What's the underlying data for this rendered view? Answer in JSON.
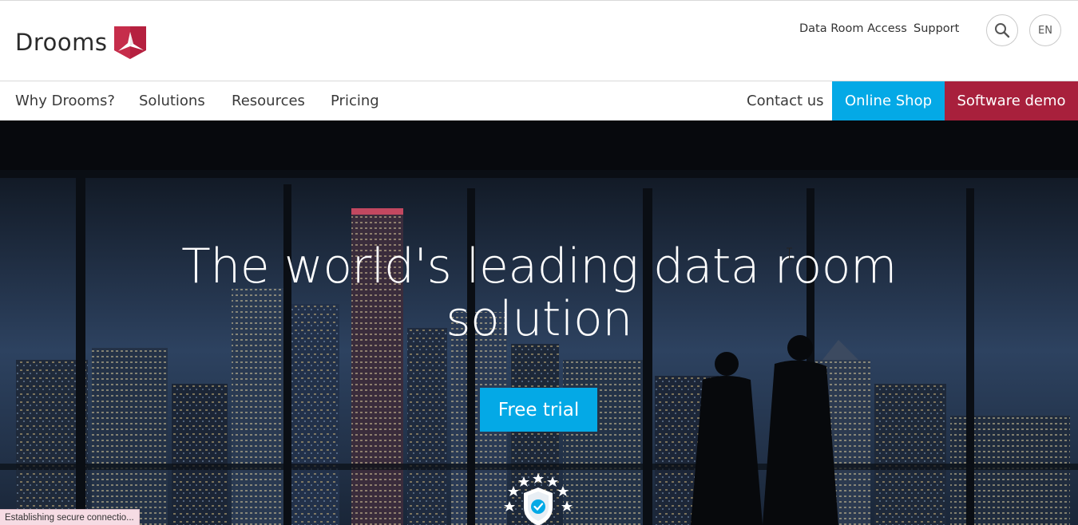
{
  "header": {
    "logo_text": "Drooms",
    "top_links": [
      "Data Room Access",
      "Support"
    ],
    "search_icon": "search-icon",
    "language": "EN"
  },
  "nav": {
    "items": [
      "Why Drooms?",
      "Solutions",
      "Resources",
      "Pricing"
    ],
    "contact": "Contact us",
    "online_shop": "Online Shop",
    "software_demo": "Software demo"
  },
  "hero": {
    "title_line1": "The world's leading data room",
    "title_line2": "solution",
    "cta": "Free trial",
    "badge_icon": "shield-check-stars-icon"
  },
  "status_bar": {
    "text": "Establishing secure connectio..."
  },
  "colors": {
    "brand_red": "#b5203f",
    "accent_blue": "#04a9e6",
    "software_demo_bg": "#a8203c"
  }
}
